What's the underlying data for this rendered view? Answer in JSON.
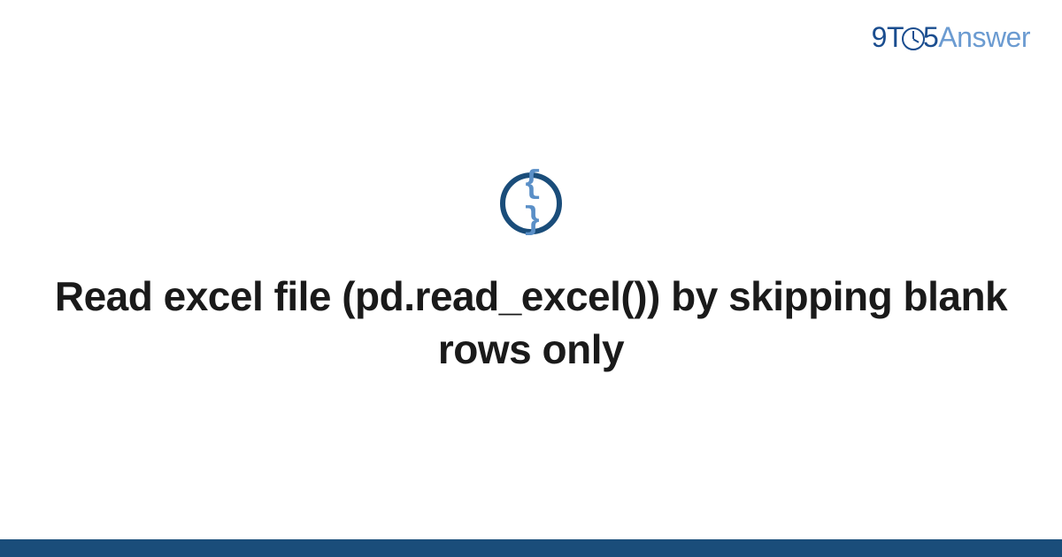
{
  "logo": {
    "nine": "9",
    "t": "T",
    "five": "5",
    "answer": "Answer"
  },
  "icon": {
    "braces": "{ }"
  },
  "title": "Read excel file (pd.read_excel()) by skipping blank rows only",
  "colors": {
    "primary": "#1a4d7a",
    "logo_dark": "#1a4d8f",
    "logo_light": "#6b9bd1",
    "icon_inner": "#5a8fc7"
  }
}
